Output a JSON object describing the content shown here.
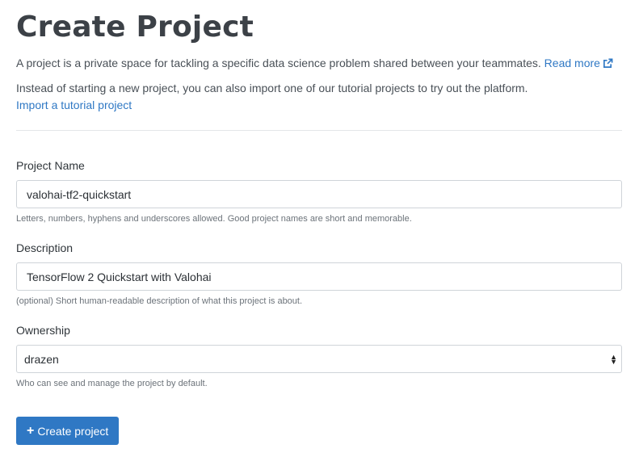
{
  "page": {
    "title": "Create Project",
    "intro_text": "A project is a private space for tackling a specific data science problem shared between your teammates.",
    "read_more_label": "Read more",
    "tutorial_text": "Instead of starting a new project, you can also import one of our tutorial projects to try out the platform.",
    "import_tutorial_label": "Import a tutorial project"
  },
  "form": {
    "project_name": {
      "label": "Project Name",
      "value": "valohai-tf2-quickstart",
      "help": "Letters, numbers, hyphens and underscores allowed. Good project names are short and memorable."
    },
    "description": {
      "label": "Description",
      "value": "TensorFlow 2 Quickstart with Valohai",
      "help": "(optional) Short human-readable description of what this project is about."
    },
    "ownership": {
      "label": "Ownership",
      "selected": "drazen",
      "help": "Who can see and manage the project by default."
    },
    "submit_label": "Create project"
  },
  "icons": {
    "external_link": "external-link-icon",
    "plus": "plus-icon",
    "select_caret": "chevron-up-down-icon"
  },
  "colors": {
    "link": "#2f78c4",
    "primary_button": "#2f78c4",
    "heading": "#3c4147"
  }
}
